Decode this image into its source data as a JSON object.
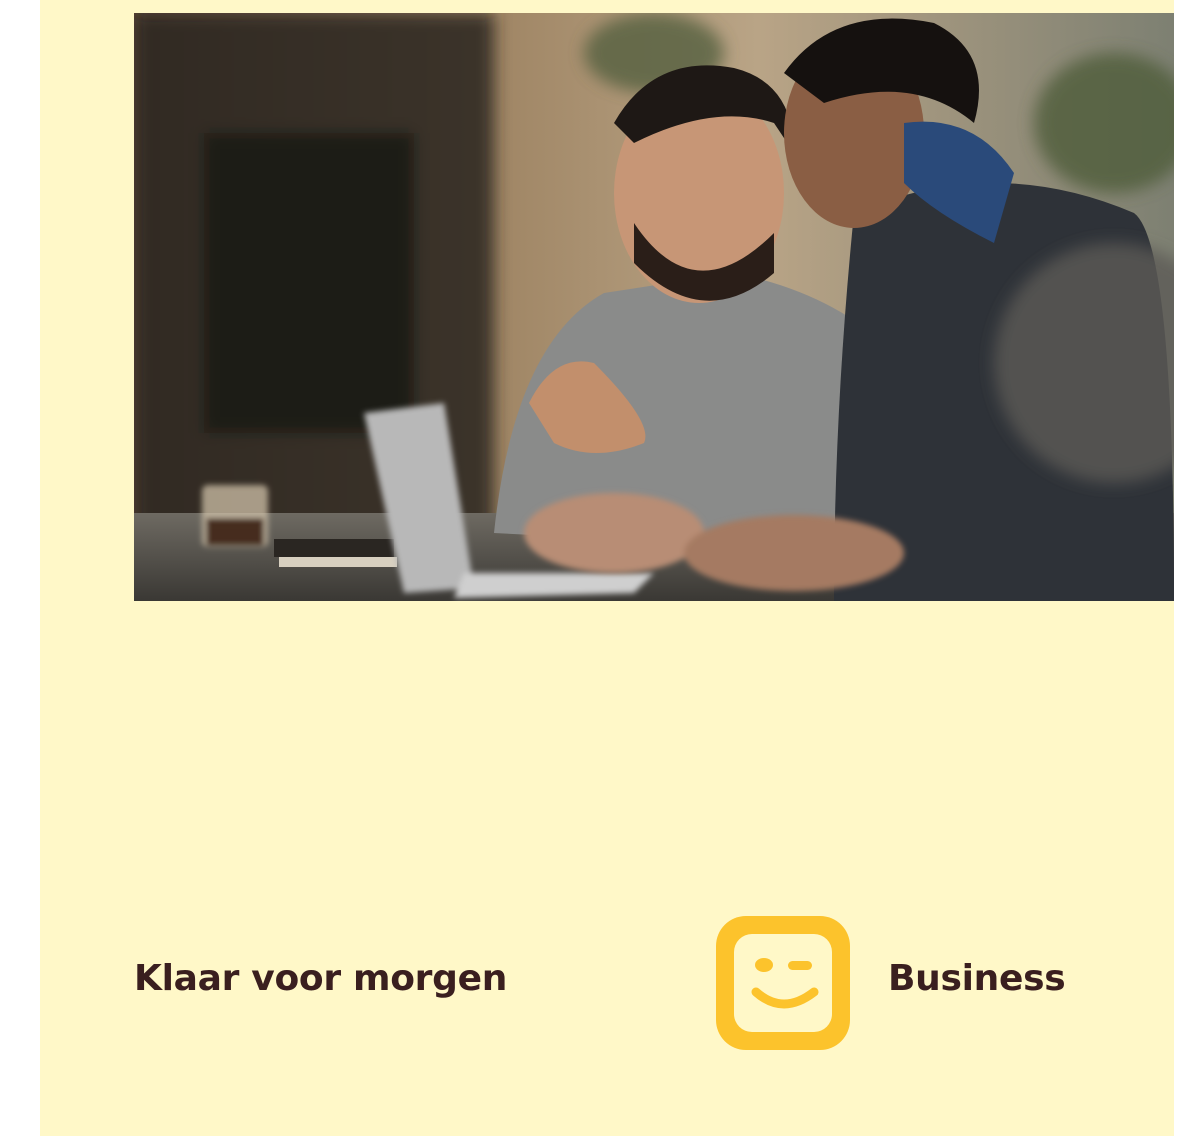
{
  "tagline": "Klaar voor morgen",
  "brand": {
    "name": "Business",
    "logo_icon": "smiley-wink-icon",
    "logo_color": "#fcc32c"
  },
  "photo": {
    "subject": "photo-two-men-at-laptop"
  },
  "colors": {
    "background": "#fff8c8",
    "text": "#3a1f1f",
    "accent": "#fcc32c"
  }
}
